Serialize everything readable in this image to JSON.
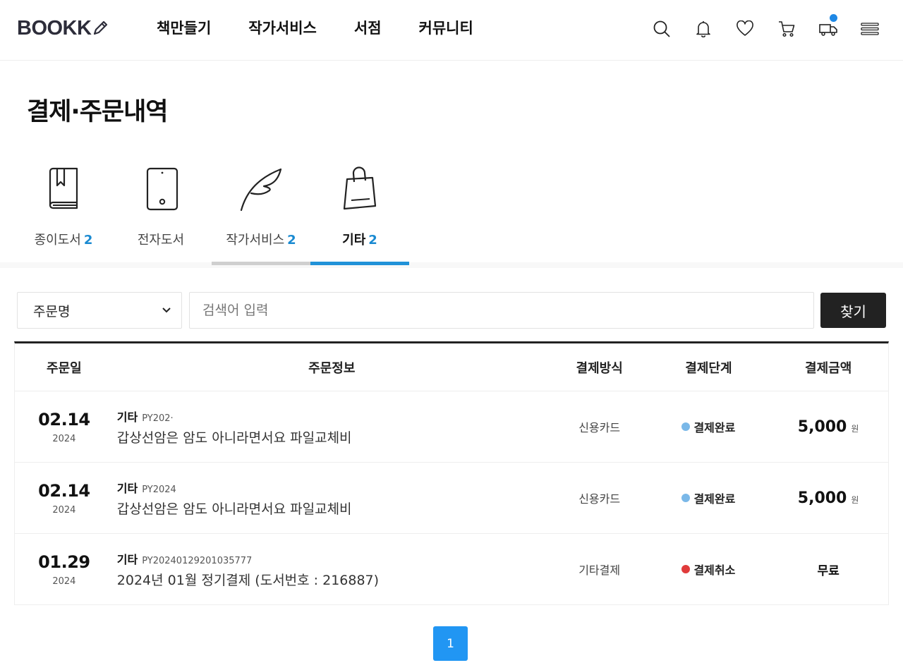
{
  "header": {
    "logo": "BOOKK",
    "nav": [
      "책만들기",
      "작가서비스",
      "서점",
      "커뮤니티"
    ],
    "icons": [
      "search-icon",
      "bell-icon",
      "heart-icon",
      "cart-icon",
      "delivery-truck-icon",
      "menu-icon"
    ]
  },
  "page": {
    "title": "결제·주문내역"
  },
  "tabs": [
    {
      "label": "종이도서",
      "count": "2",
      "icon": "paper-book-icon"
    },
    {
      "label": "전자도서",
      "count": "",
      "icon": "ebook-tablet-icon"
    },
    {
      "label": "작가서비스",
      "count": "2",
      "icon": "feather-quill-icon"
    },
    {
      "label": "기타",
      "count": "2",
      "icon": "shopping-bag-icon",
      "active": true
    }
  ],
  "search": {
    "select_value": "주문명",
    "placeholder": "검색어 입력",
    "button": "찾기"
  },
  "table": {
    "headers": [
      "주문일",
      "주문정보",
      "결제방식",
      "결제단계",
      "결제금액"
    ],
    "rows": [
      {
        "date": "02.14",
        "year": "2024",
        "category": "기타",
        "order_no": "PY202·",
        "name": "갑상선암은 암도 아니라면서요 파일교체비",
        "method": "신용카드",
        "status": "결제완료",
        "amount": "5,000",
        "unit": "원",
        "free": ""
      },
      {
        "date": "02.14",
        "year": "2024",
        "category": "기타",
        "order_no": "PY2024",
        "name": "갑상선암은 암도 아니라면서요 파일교체비",
        "method": "신용카드",
        "status": "결제완료",
        "amount": "5,000",
        "unit": "원",
        "free": ""
      },
      {
        "date": "01.29",
        "year": "2024",
        "category": "기타",
        "order_no": "PY20240129201035777",
        "name": "2024년 01월 정기결제 (도서번호 : 216887)",
        "method": "기타결제",
        "status": "결제취소",
        "amount": "",
        "unit": "",
        "free": "무료"
      }
    ]
  },
  "colors": {
    "accent": "#1a8ad1",
    "status_complete": "#7ab8e8",
    "status_cancel": "#e03b3b",
    "page_active": "#2196f3"
  },
  "pagination": {
    "current": "1"
  }
}
